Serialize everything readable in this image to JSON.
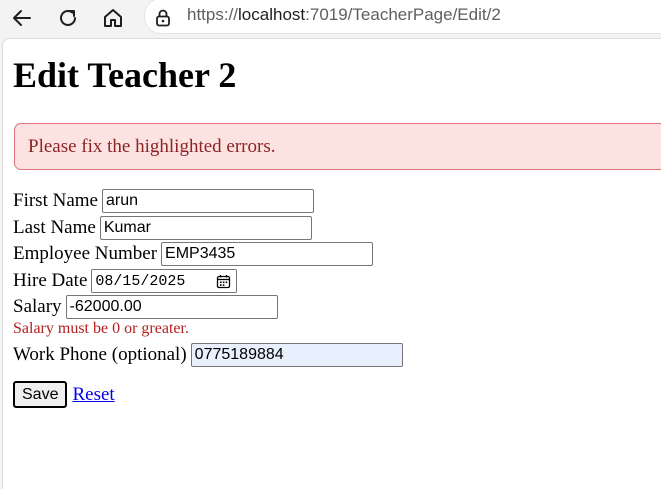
{
  "browser": {
    "url_prefix": "https://",
    "url_host": "localhost",
    "url_rest": ":7019/TeacherPage/Edit/2"
  },
  "page": {
    "title": "Edit Teacher 2",
    "alert": "Please fix the highlighted errors.",
    "fields": {
      "first_name": {
        "label": "First Name",
        "value": "arun"
      },
      "last_name": {
        "label": "Last Name",
        "value": "Kumar"
      },
      "employee_number": {
        "label": "Employee Number",
        "value": "EMP3435"
      },
      "hire_date": {
        "label": "Hire Date",
        "value": "08/15/2025"
      },
      "salary": {
        "label": "Salary",
        "value": "-62000.00",
        "error": "Salary must be 0 or greater."
      },
      "work_phone": {
        "label": "Work Phone (optional)",
        "value": "0775189884"
      }
    },
    "save_label": "Save",
    "reset_label": "Reset"
  }
}
